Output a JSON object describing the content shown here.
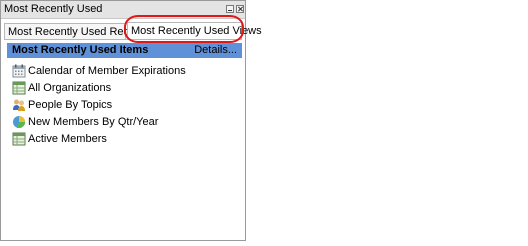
{
  "window": {
    "title": "Most Recently Used"
  },
  "tabs": [
    {
      "label": "Most Recently Used Records"
    },
    {
      "label": "Most Recently Used Views"
    }
  ],
  "section": {
    "title": "Most Recently Used Items",
    "details_label": "Details..."
  },
  "items": [
    {
      "label": "Calendar of Member Expirations",
      "icon": "calendar-icon"
    },
    {
      "label": "All Organizations",
      "icon": "list-view-icon"
    },
    {
      "label": "People By Topics",
      "icon": "people-icon"
    },
    {
      "label": "New Members By Qtr/Year",
      "icon": "pie-chart-icon"
    },
    {
      "label": "Active Members",
      "icon": "list-view-icon"
    }
  ],
  "colors": {
    "header_bg": "#5f91d8",
    "highlight_ring": "#e01818",
    "titlebar_bg": "#e4e4e4"
  }
}
